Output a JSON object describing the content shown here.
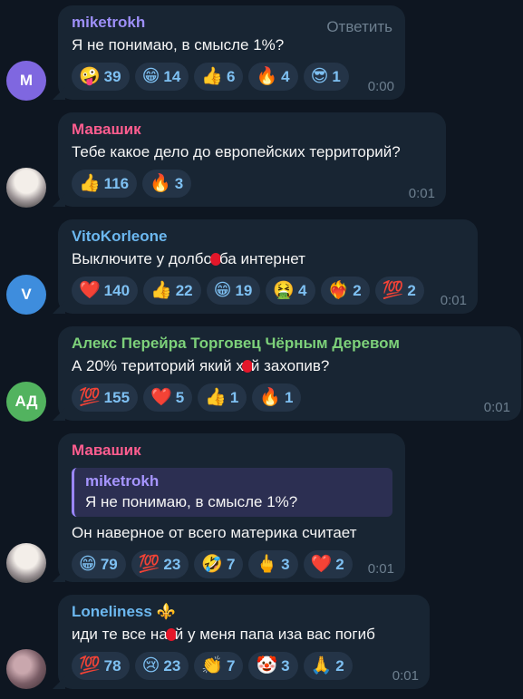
{
  "reply_label": "Ответить",
  "messages": [
    {
      "sender": "miketrokh",
      "sender_color": "#9d8ff8",
      "avatar_text": "М",
      "avatar_color": "#7f67e0",
      "text": "Я не понимаю, в смысле 1%?",
      "time": "0:00",
      "reactions": [
        {
          "emoji": "🤪",
          "count": "39"
        },
        {
          "emoji": "😁",
          "count": "14"
        },
        {
          "emoji": "👍",
          "count": "6"
        },
        {
          "emoji": "🔥",
          "count": "4"
        },
        {
          "emoji": "😎",
          "count": "1"
        }
      ]
    },
    {
      "sender": "Мавашик",
      "sender_color": "#ff5d8f",
      "avatar_text": "",
      "avatar_color": "#c8c2c4",
      "text": "Тебе какое дело до европейских территорий?",
      "time": "0:01",
      "reactions": [
        {
          "emoji": "👍",
          "count": "116"
        },
        {
          "emoji": "🔥",
          "count": "3"
        }
      ]
    },
    {
      "sender": "VitoKorleone",
      "sender_color": "#6cb8f0",
      "avatar_text": "V",
      "avatar_color": "#3e8ddd",
      "text_before": "Выключите у долбо",
      "text_after": "ба интернет",
      "time": "0:01",
      "reactions": [
        {
          "emoji": "❤️",
          "count": "140"
        },
        {
          "emoji": "👍",
          "count": "22"
        },
        {
          "emoji": "😁",
          "count": "19"
        },
        {
          "emoji": "🤮",
          "count": "4"
        },
        {
          "emoji": "❤️‍🔥",
          "count": "2"
        },
        {
          "emoji": "💯",
          "count": "2"
        }
      ]
    },
    {
      "sender": "Алекс Перейра Торговец Чёрным Деревом",
      "sender_color": "#7dd17a",
      "avatar_text": "АД",
      "avatar_color": "#52b35f",
      "text_before": "А 20% територий який х",
      "text_after": "й захопив?",
      "time": "0:01",
      "reactions": [
        {
          "emoji": "💯",
          "count": "155"
        },
        {
          "emoji": "❤️",
          "count": "5"
        },
        {
          "emoji": "👍",
          "count": "1"
        },
        {
          "emoji": "🔥",
          "count": "1"
        }
      ]
    },
    {
      "sender": "Мавашик",
      "sender_color": "#ff5d8f",
      "avatar_text": "",
      "avatar_color": "#c8c2c4",
      "quote_name": "miketrokh",
      "quote_text": "Я не понимаю, в смысле 1%?",
      "text": "Он наверное от всего материка считает",
      "time": "0:01",
      "reactions": [
        {
          "emoji": "😁",
          "count": "79"
        },
        {
          "emoji": "💯",
          "count": "23"
        },
        {
          "emoji": "🤣",
          "count": "7"
        },
        {
          "emoji": "🖕",
          "count": "3"
        },
        {
          "emoji": "❤️",
          "count": "2"
        }
      ]
    },
    {
      "sender": "Loneliness ⚜️",
      "sender_color": "#6cb8f0",
      "avatar_text": "",
      "avatar_color": "#8a6c74",
      "text_before": "иди те все на",
      "text_after": "й у меня папа иза вас погиб",
      "time": "0:01",
      "reactions": [
        {
          "emoji": "💯",
          "count": "78"
        },
        {
          "emoji": "😢",
          "count": "23"
        },
        {
          "emoji": "👏",
          "count": "7"
        },
        {
          "emoji": "🤡",
          "count": "3"
        },
        {
          "emoji": "🙏",
          "count": "2"
        }
      ]
    }
  ]
}
